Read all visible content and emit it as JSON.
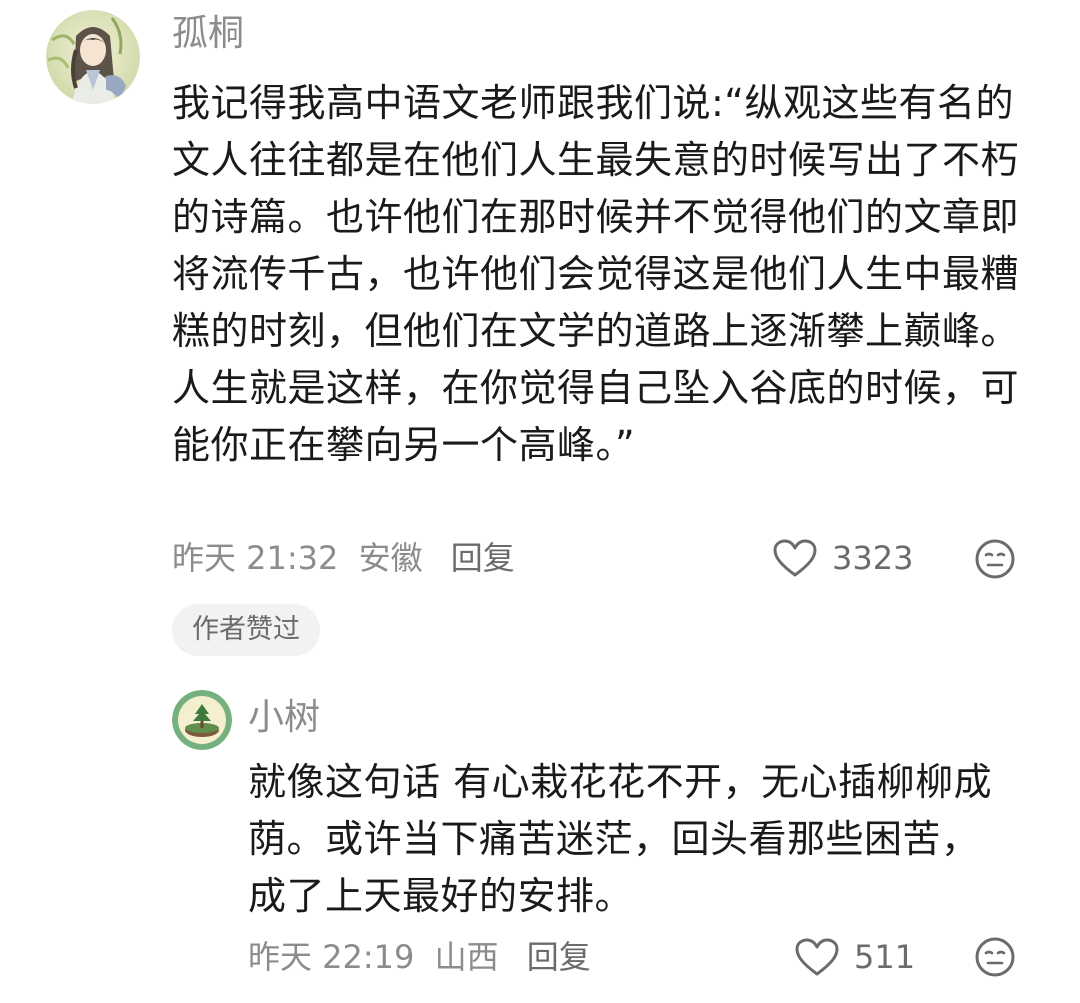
{
  "comments": [
    {
      "username": "孤桐",
      "text": "我记得我高中语文老师跟我们说:“纵观这些有名的文人往往都是在他们人生最失意的时候写出了不朽的诗篇。也许他们在那时候并不觉得他们的文章即将流传千古，也许他们会觉得这是他们人生中最糟糕的时刻，但他们在文学的道路上逐渐攀上巅峰。人生就是这样，在你觉得自己坠入谷底的时候，可能你正在攀向另一个高峰。”",
      "time": "昨天 21:32",
      "location": "安徽",
      "reply_label": "回复",
      "likes": "3323",
      "badge": "作者赞过",
      "avatar_icon": "anime-character-avatar",
      "like_icon": "heart-outline-icon",
      "emoji_icon": "neutral-face-icon"
    },
    {
      "username": "小树",
      "text": "就像这句话 有心栽花花不开，无心插柳柳成荫。或许当下痛苦迷茫，回头看那些困苦，成了上天最好的安排。",
      "time": "昨天 22:19",
      "location": "山西",
      "reply_label": "回复",
      "likes": "511",
      "avatar_icon": "tree-avatar",
      "like_icon": "heart-outline-icon",
      "emoji_icon": "neutral-face-icon"
    }
  ],
  "colors": {
    "text_primary": "#1a1a1a",
    "text_secondary": "#8c8c8c",
    "badge_bg": "#f2f2f2"
  }
}
